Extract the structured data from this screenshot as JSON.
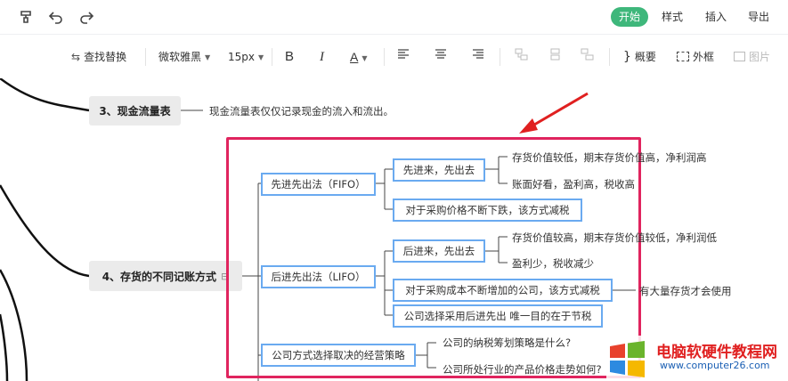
{
  "topbar": {
    "tabs": {
      "start": "开始",
      "style": "样式",
      "insert": "插入",
      "export": "导出"
    }
  },
  "toolbar": {
    "find_replace": "查找替换",
    "font_family": "微软雅黑",
    "font_size": "15px",
    "bold": "B",
    "italic": "I",
    "font_color": "A",
    "summary": "概要",
    "outer_frame": "外框",
    "image": "图片"
  },
  "mindmap": {
    "node3": {
      "label": "3、现金流量表",
      "note": "现金流量表仅仅记录现金的流入和流出。"
    },
    "node4": {
      "label": "4、存货的不同记账方式",
      "expand_mark": "⊟",
      "fifo": {
        "label": "先进先出法（FIFO）",
        "sub1": "先进来，先出去",
        "sub1_a": "存货价值较低，期末存货价值高，净利润高",
        "sub1_b": "账面好看，盈利高，税收高",
        "sub2": "对于采购价格不断下跌，该方式减税"
      },
      "lifo": {
        "label": "后进先出法（LIFO）",
        "sub1": "后进来，先出去",
        "sub1_a": "存货价值较高，期末存货价值较低，净利润低",
        "sub1_b": "盈利少，税收减少",
        "sub2": "对于采购成本不断增加的公司，该方式减税",
        "sub2_note": "有大量存货才会使用",
        "sub3": "公司选择采用后进先出 唯一目的在于节税"
      },
      "strategy": {
        "label": "公司方式选择取决的经营策略",
        "q1": "公司的纳税筹划策略是什么?",
        "q2": "公司所处行业的产品价格走势如何?"
      }
    }
  },
  "watermark": {
    "title": "电脑软硬件教程网",
    "url": "www.computer26.com"
  },
  "colors": {
    "accent": "#3eb77b",
    "node_border": "#6aaaf0",
    "highlight": "#e0245e",
    "arrow": "#e02020"
  }
}
